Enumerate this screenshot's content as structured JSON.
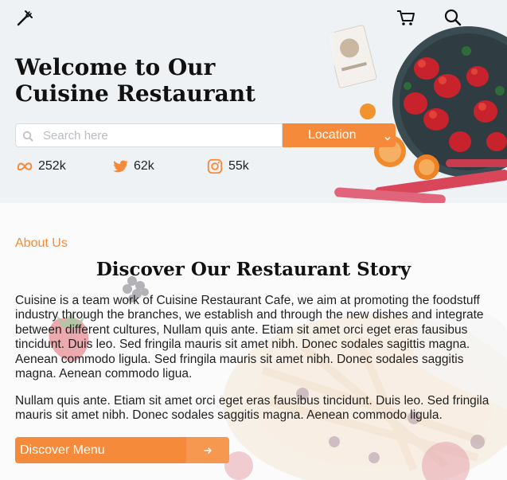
{
  "header": {
    "logo_icon": "fork-knife-icon",
    "cart_icon": "cart-icon",
    "search_icon": "search-icon"
  },
  "hero": {
    "title_line1": "Welcome to Our",
    "title_line2": "Cuisine Restaurant",
    "search_placeholder": "Search here",
    "location_label": "Location",
    "stats": [
      {
        "icon": "meta-icon",
        "value": "252k"
      },
      {
        "icon": "twitter-icon",
        "value": "62k"
      },
      {
        "icon": "instagram-icon",
        "value": "55k"
      }
    ]
  },
  "about": {
    "kicker": "About Us",
    "title": "Discover Our Restaurant Story",
    "paragraph1": "Cuisine is a team work of Cuisine Restaurant Cafe, we aim at promoting the foodstuff industry through the branches, we establish and through the new dishes and integrate between different cultures, Nullam quis ante. Etiam sit amet orci eget eras fausibus tincidunt. Duis leo. Sed fringila mauris sit amet nibh. Donec sodales sagittis magna. Aenean commodo ligula. Sed fringila mauris sit amet nibh. Donec sodales saggitis magna. Aenean commodo ligua.",
    "paragraph2": "Nullam quis ante. Etiam sit amet orci eget eras fausibus tincidunt. Duis leo. Sed fringila mauris sit amet nibh. Donec sodales saggitis magna. Aenean commodo ligula.",
    "button_label": "Discover Menu"
  },
  "colors": {
    "accent": "#f58a3a",
    "text": "#111111"
  }
}
